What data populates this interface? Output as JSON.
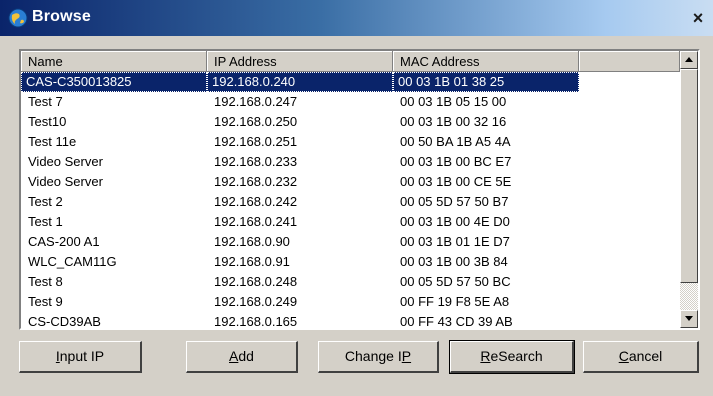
{
  "window": {
    "title": "Browse",
    "close_label": "×"
  },
  "columns": [
    "Name",
    "IP Address",
    "MAC Address",
    ""
  ],
  "rows": [
    {
      "name": "CAS-C350013825",
      "ip": "192.168.0.240",
      "mac": "00 03 1B 01 38 25"
    },
    {
      "name": "Test 7",
      "ip": "192.168.0.247",
      "mac": "00 03 1B 05 15 00"
    },
    {
      "name": "Test10",
      "ip": "192.168.0.250",
      "mac": "00 03 1B 00 32 16"
    },
    {
      "name": "Test 11e",
      "ip": "192.168.0.251",
      "mac": "00 50 BA 1B A5 4A"
    },
    {
      "name": "Video Server",
      "ip": "192.168.0.233",
      "mac": "00 03 1B 00 BC E7"
    },
    {
      "name": "Video Server",
      "ip": "192.168.0.232",
      "mac": "00 03 1B 00 CE 5E"
    },
    {
      "name": "Test 2",
      "ip": "192.168.0.242",
      "mac": "00 05 5D 57 50 B7"
    },
    {
      "name": "Test 1",
      "ip": "192.168.0.241",
      "mac": "00 03 1B 00 4E D0"
    },
    {
      "name": "CAS-200 A1",
      "ip": "192.168.0.90",
      "mac": "00 03 1B 01 1E D7"
    },
    {
      "name": "WLC_CAM11G",
      "ip": "192.168.0.91",
      "mac": "00 03 1B 00 3B 84"
    },
    {
      "name": "Test 8",
      "ip": "192.168.0.248",
      "mac": "00 05 5D 57 50 BC"
    },
    {
      "name": "Test 9",
      "ip": "192.168.0.249",
      "mac": "00 FF 19 F8 5E A8"
    },
    {
      "name": "CS-CD39AB",
      "ip": "192.168.0.165",
      "mac": "00 FF 43 CD 39 AB"
    }
  ],
  "selected_row": 0,
  "buttons": {
    "input_ip": {
      "pre": "",
      "key": "I",
      "post": "nput IP"
    },
    "add": {
      "pre": "",
      "key": "A",
      "post": "dd"
    },
    "change_ip": {
      "pre": "Change I",
      "key": "P",
      "post": ""
    },
    "research": {
      "pre": "",
      "key": "R",
      "post": "eSearch"
    },
    "cancel": {
      "pre": "",
      "key": "C",
      "post": "ancel"
    }
  },
  "colors": {
    "selection": "#0a246a",
    "face": "#d4d0c8",
    "title_start": "#0a246a",
    "title_end": "#c9ddf2"
  },
  "icons": {
    "app": "globe-icon",
    "scroll_up": "triangle-up-icon",
    "scroll_down": "triangle-down-icon"
  }
}
